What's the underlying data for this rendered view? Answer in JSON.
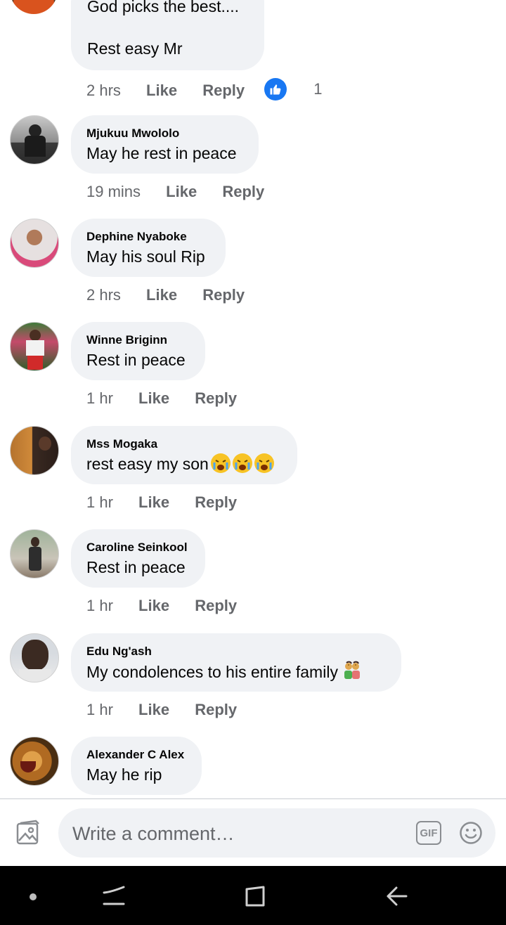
{
  "comments_top": {
    "line1": "God picks the best....",
    "line2": "Rest easy Mr",
    "time": "2 hrs",
    "like_label": "Like",
    "reply_label": "Reply",
    "reaction_count": "1"
  },
  "comments": [
    {
      "author": "Mjukuu Mwololo",
      "text": "May he rest in peace",
      "time": "19 mins",
      "like_label": "Like",
      "reply_label": "Reply"
    },
    {
      "author": "Dephine Nyaboke",
      "text": "May his soul Rip",
      "time": "2 hrs",
      "like_label": "Like",
      "reply_label": "Reply"
    },
    {
      "author": "Winne Briginn",
      "text": "Rest in peace",
      "time": "1 hr",
      "like_label": "Like",
      "reply_label": "Reply"
    },
    {
      "author": "Mss Mogaka",
      "text": "rest easy my son",
      "emojis": [
        "crying-face",
        "crying-face",
        "crying-face"
      ],
      "time": "1 hr",
      "like_label": "Like",
      "reply_label": "Reply"
    },
    {
      "author": "Caroline Seinkool",
      "text": "Rest in peace",
      "time": "1 hr",
      "like_label": "Like",
      "reply_label": "Reply"
    },
    {
      "author": "Edu Ng'ash",
      "text": "My condolences to his entire family",
      "emojis": [
        "couple-emoji"
      ],
      "time": "1 hr",
      "like_label": "Like",
      "reply_label": "Reply"
    },
    {
      "author": "Alexander C Alex",
      "text": "May he rip"
    }
  ],
  "composer": {
    "placeholder": "Write a comment…",
    "gif_label": "GIF",
    "icons": [
      "photo-icon",
      "gif-icon",
      "emoji-icon"
    ]
  },
  "navbar": {
    "icons": [
      "menu-dot-icon",
      "recent-apps-icon",
      "home-icon",
      "back-icon"
    ]
  },
  "colors": {
    "bubble": "#f0f2f5",
    "meta_text": "#65676b",
    "like_blue": "#1877f2",
    "navbar": "#000000"
  }
}
